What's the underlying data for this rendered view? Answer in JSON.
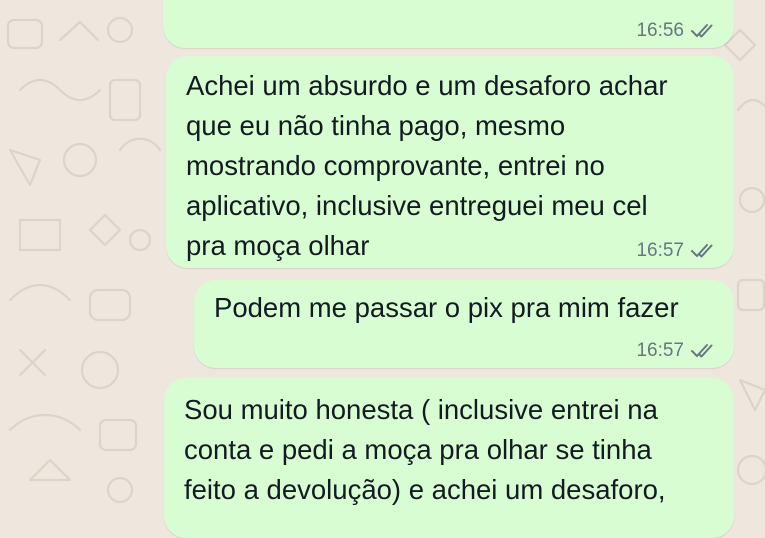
{
  "colors": {
    "background": "#efe7dd",
    "outgoing_bubble": "#d9fdd3",
    "text": "#111b21",
    "meta": "#667781"
  },
  "messages": [
    {
      "text": "",
      "time": "16:56",
      "status_icon": "double-check-icon"
    },
    {
      "text": "Achei um absurdo e um desaforo achar\nque eu não tinha pago, mesmo\nmostrando comprovante, entrei no\naplicativo, inclusive entreguei meu cel\npra moça olhar",
      "time": "16:57",
      "status_icon": "double-check-icon"
    },
    {
      "text": "Podem me passar o pix pra mim fazer",
      "time": "16:57",
      "status_icon": "double-check-icon"
    },
    {
      "text": "Sou muito honesta ( inclusive entrei na\nconta e pedi a moça pra olhar se tinha\nfeito a devolução) e achei um desaforo,",
      "time": "",
      "status_icon": ""
    }
  ]
}
